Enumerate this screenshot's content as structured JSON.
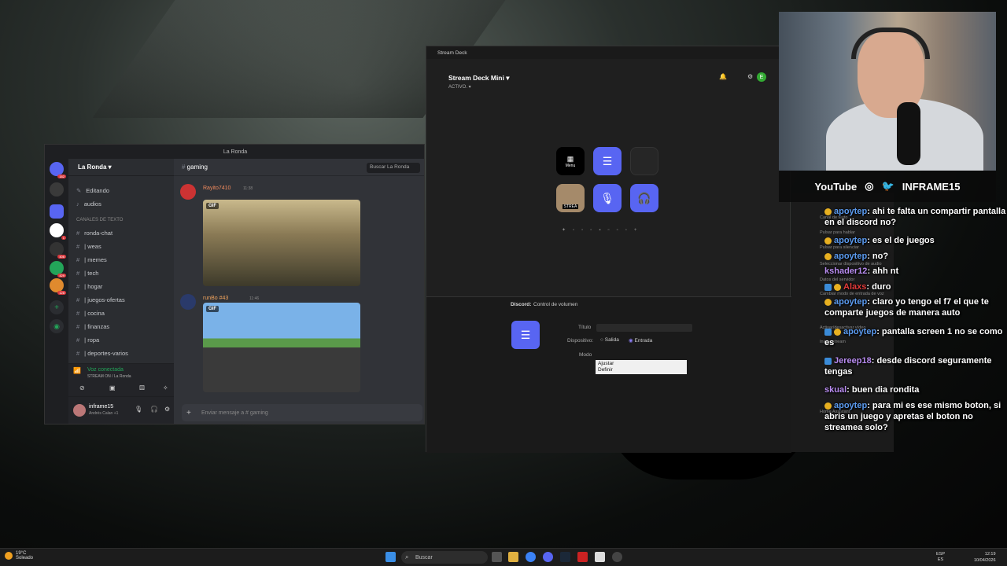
{
  "discord": {
    "title": "La Ronda",
    "guild_name": "La Ronda",
    "channel_items_top": [
      "Editando",
      "audios"
    ],
    "category": "CANALES DE TEXTO",
    "channels": [
      "ronda-chat",
      "| weas",
      "| memes",
      "| tech",
      "| hogar",
      "| juegos-ofertas",
      "| cocina",
      "| finanzas",
      "| ropa",
      "| deportes-varios"
    ],
    "server_badges": [
      "182",
      "1",
      "406",
      "429",
      "128"
    ],
    "voice_status": "Voz conectada",
    "voice_sub": "STREAM ON / La Ronda",
    "user_name": "inframe15",
    "user_status": "Andrés Calan +1",
    "chat_channel": "gaming",
    "search_placeholder": "Buscar La Ronda",
    "messages": [
      {
        "author": "Rayito7410",
        "time": "11:38",
        "tag": "GIF"
      },
      {
        "author": "runBo #43",
        "time": "11:46",
        "tag": "GIF"
      }
    ],
    "input_placeholder": "Enviar mensaje a # gaming"
  },
  "stream_deck": {
    "window_title": "Stream Deck",
    "device": "Stream Deck Mini",
    "profile": "ACTIVO.",
    "keys": [
      {
        "label": "Menu",
        "icon": "grid-icon"
      },
      {
        "label": "",
        "icon": "mixer-icon"
      },
      {
        "label": "",
        "icon": "empty"
      },
      {
        "label": "STREA",
        "icon": "avatar-icon"
      },
      {
        "label": "",
        "icon": "microphone-icon"
      },
      {
        "label": "",
        "icon": "headset-icon"
      }
    ],
    "props_plugin": "Discord:",
    "props_action": "Control de volumen",
    "title_label": "Título",
    "device_label": "Dispositivo:",
    "option_out": "Salida",
    "option_in": "Entrada",
    "mode_label": "Modo",
    "mode_options": [
      "Ajustar",
      "Definir"
    ]
  },
  "side_panel": [
    "Canal de texto",
    "Pulsar para hablar",
    "Pulsar para silenciar",
    "Seleccionar dispositivo de audio",
    "Datos del servidor",
    "Cambiar modo de entrada de voz",
    "Activar/desactivar vídeo",
    "Iniciar stream",
    "Home Assistant"
  ],
  "overlay": {
    "socials": [
      "YouTube",
      "INFRAME15"
    ]
  },
  "chat": [
    {
      "user": "apoytep",
      "color": "#5b9bf0",
      "text": ": ahi te falta un compartir pantalla en el discord no?",
      "badge": "1"
    },
    {
      "user": "apoytep",
      "color": "#5b9bf0",
      "text": ": es el de juegos",
      "badge": "1"
    },
    {
      "user": "apoytep",
      "color": "#5b9bf0",
      "text": ": no?",
      "badge": "1"
    },
    {
      "user": "kshader12",
      "color": "#b88cf0",
      "text": ": ahh nt",
      "badge": ""
    },
    {
      "user": "Alaxs",
      "color": "#e23a3a",
      "text": ": duro",
      "badge": "1"
    },
    {
      "user": "apoytep",
      "color": "#5b9bf0",
      "text": ": claro yo tengo el f7 el que te comparte juegos de manera auto",
      "badge": "1"
    },
    {
      "user": "apoytep",
      "color": "#5b9bf0",
      "text": ": pantalla screen 1 no se como es",
      "badge": "1"
    },
    {
      "user": "Jereep18",
      "color": "#b88cf0",
      "text": ": desde discord seguramente tengas",
      "badge": ""
    },
    {
      "user": "skual",
      "color": "#b88cf0",
      "text": ": buen dia rondita",
      "badge": ""
    },
    {
      "user": "apoytep",
      "color": "#5b9bf0",
      "text": ": para mi es ese mismo boton, si abris un juego y apretas el boton no streamea solo?",
      "badge": "1"
    }
  ],
  "taskbar": {
    "temp": "19°C",
    "weather": "Soleado",
    "search": "Buscar",
    "lang": "ESP",
    "region": "ES",
    "time": "12:19",
    "date": "10/04/2026"
  }
}
